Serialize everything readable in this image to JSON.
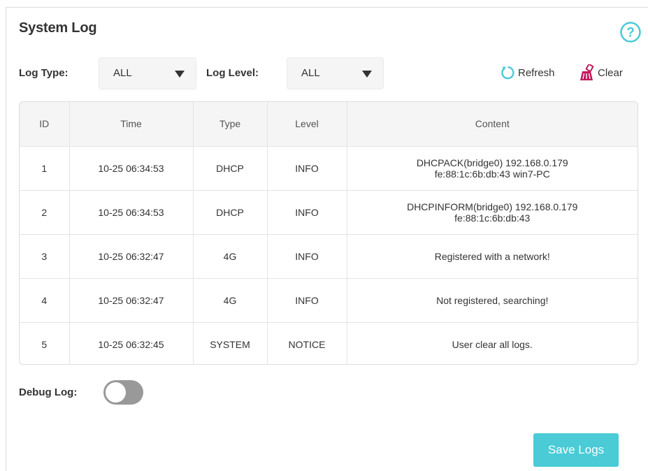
{
  "page": {
    "title": "System Log"
  },
  "filters": {
    "log_type_label": "Log Type:",
    "log_type_value": "ALL",
    "log_level_label": "Log Level:",
    "log_level_value": "ALL"
  },
  "actions": {
    "refresh_label": "Refresh",
    "clear_label": "Clear"
  },
  "table": {
    "headers": [
      "ID",
      "Time",
      "Type",
      "Level",
      "Content"
    ],
    "rows": [
      {
        "id": "1",
        "time": "10-25 06:34:53",
        "type": "DHCP",
        "level": "INFO",
        "content": [
          "DHCPACK(bridge0) 192.168.0.179",
          "fe:88:1c:6b:db:43 win7-PC"
        ]
      },
      {
        "id": "2",
        "time": "10-25 06:34:53",
        "type": "DHCP",
        "level": "INFO",
        "content": [
          "DHCPINFORM(bridge0) 192.168.0.179",
          "fe:88:1c:6b:db:43"
        ]
      },
      {
        "id": "3",
        "time": "10-25 06:32:47",
        "type": "4G",
        "level": "INFO",
        "content": [
          "Registered with a network!"
        ]
      },
      {
        "id": "4",
        "time": "10-25 06:32:47",
        "type": "4G",
        "level": "INFO",
        "content": [
          "Not registered, searching!"
        ]
      },
      {
        "id": "5",
        "time": "10-25 06:32:45",
        "type": "SYSTEM",
        "level": "NOTICE",
        "content": [
          "User clear all logs."
        ]
      }
    ]
  },
  "debug": {
    "label": "Debug Log:",
    "enabled": false
  },
  "footer": {
    "save_label": "Save Logs"
  },
  "icons": {
    "help": "help-circle-icon",
    "refresh": "refresh-icon",
    "clear": "broom-icon",
    "dropdown": "caret-down-icon"
  },
  "colors": {
    "accent": "#4acbd6",
    "clear_icon": "#c2185b",
    "toggle_off": "#999999",
    "header_bg": "#f5f5f5"
  }
}
